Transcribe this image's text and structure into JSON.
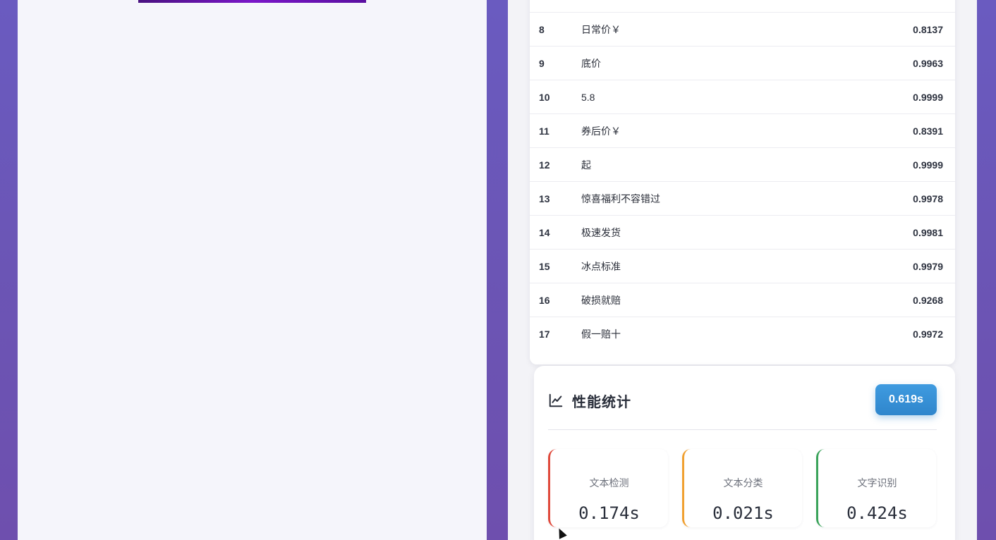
{
  "ocr_table": {
    "rows": [
      {
        "index": "8",
        "text": "日常价￥",
        "score": "0.8137"
      },
      {
        "index": "9",
        "text": "底价",
        "score": "0.9963"
      },
      {
        "index": "10",
        "text": "5.8",
        "score": "0.9999"
      },
      {
        "index": "11",
        "text": "券后价￥",
        "score": "0.8391"
      },
      {
        "index": "12",
        "text": "起",
        "score": "0.9999"
      },
      {
        "index": "13",
        "text": "惊喜福利不容错过",
        "score": "0.9978"
      },
      {
        "index": "14",
        "text": "极速发货",
        "score": "0.9981"
      },
      {
        "index": "15",
        "text": "冰点标准",
        "score": "0.9979"
      },
      {
        "index": "16",
        "text": "破损就赔",
        "score": "0.9268"
      },
      {
        "index": "17",
        "text": "假一赔十",
        "score": "0.9972"
      }
    ]
  },
  "performance": {
    "title": "性能统计",
    "icon": "line-chart-icon",
    "total_time": "0.619s",
    "stats": [
      {
        "label": "文本检测",
        "value": "0.174s",
        "accent": "#e04a3c"
      },
      {
        "label": "文本分类",
        "value": "0.021s",
        "accent": "#f0a030"
      },
      {
        "label": "文字识别",
        "value": "0.424s",
        "accent": "#3aa35a"
      }
    ]
  },
  "colors": {
    "background": "#6a5bc0",
    "badge": "#3a93d8"
  }
}
